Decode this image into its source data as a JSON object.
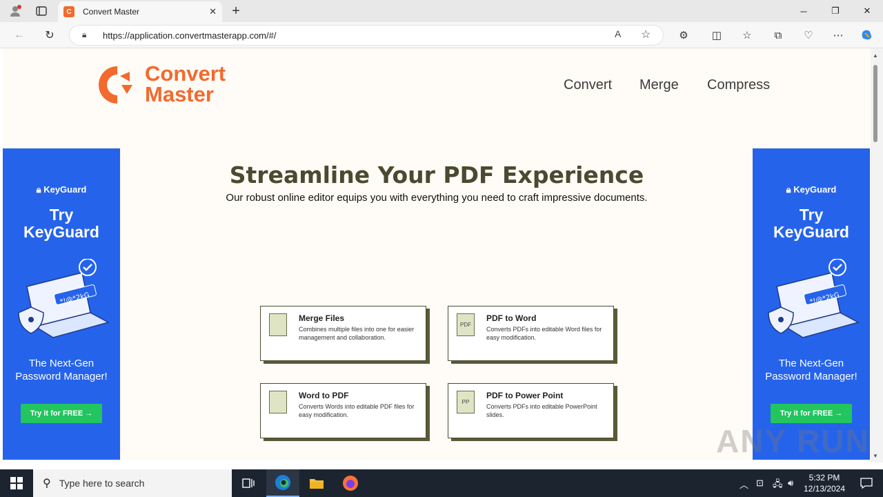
{
  "browser": {
    "tab_title": "Convert Master",
    "tab_favicon_letter": "C",
    "url": "https://application.convertmasterapp.com/#/"
  },
  "site": {
    "brand_line1": "Convert",
    "brand_line2": "Master",
    "brand_color": "#f26a2e",
    "nav": [
      "Convert",
      "Merge",
      "Compress"
    ]
  },
  "ad": {
    "brand": "KeyGuard",
    "headline_line1": "Try",
    "headline_line2": "KeyGuard",
    "tagline_line1": "The Next-Gen",
    "tagline_line2": "Password Manager!",
    "cta": "Try it for FREE →",
    "password_art": "*!@*2kG",
    "bg_color": "#2563eb",
    "cta_color": "#22c55e"
  },
  "hero": {
    "title": "Streamline Your PDF Experience",
    "subtitle": "Our robust online editor equips you with everything you need to craft impressive documents."
  },
  "cards": [
    {
      "title": "Merge Files",
      "desc": "Combines multiple files into one for easier management and collaboration.",
      "icon": "merge-files-icon",
      "icon_text": ""
    },
    {
      "title": "PDF to Word",
      "desc": "Converts PDFs into editable Word files for easy modification.",
      "icon": "pdf-file-icon",
      "icon_text": "PDF"
    },
    {
      "title": "Word to PDF",
      "desc": "Converts Words into editable PDF files for easy modification.",
      "icon": "word-file-icon",
      "icon_text": ""
    },
    {
      "title": "PDF to Power Point",
      "desc": "Converts PDFs into editable PowerPoint slides.",
      "icon": "ppt-file-icon",
      "icon_text": "PP"
    }
  ],
  "taskbar": {
    "search_placeholder": "Type here to search",
    "time": "5:32 PM",
    "date": "12/13/2024"
  },
  "watermark": "ANY RUN"
}
